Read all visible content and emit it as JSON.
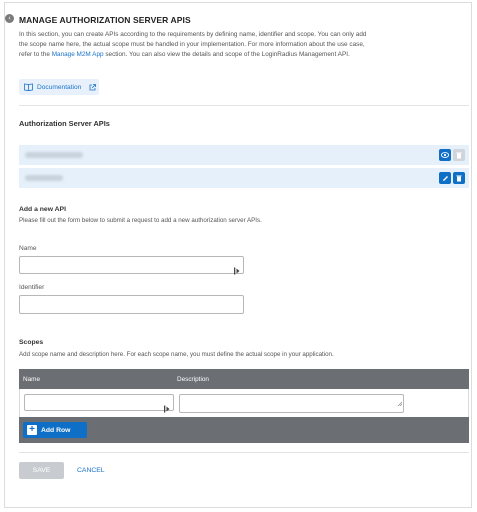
{
  "header": {
    "title": "MANAGE AUTHORIZATION SERVER APIS",
    "intro_pre": "In this section, you can create APIs according to the requirements by defining name, identifier and scope. You can only add the scope name here, the actual scope must be handled in your implementation. For more information about the use case, refer to the ",
    "intro_link": "Manage M2M App",
    "intro_post": " section. You can also view the details and scope of the LoginRadius Management API.",
    "doc_label": "Documentation"
  },
  "apis": {
    "heading": "Authorization Server APIs",
    "rows": [
      {
        "actions": [
          "eye-icon",
          "trash-icon"
        ]
      },
      {
        "actions": [
          "pencil-icon",
          "trash-icon"
        ]
      }
    ]
  },
  "add_api": {
    "heading": "Add a new API",
    "description": "Please fill out the form below to submit a request to add a new authorization server APIs.",
    "name_label": "Name",
    "name_value": "",
    "identifier_label": "Identifier",
    "identifier_value": ""
  },
  "scopes": {
    "heading": "Scopes",
    "description": "Add scope name and description here. For each scope name, you must define the actual scope in your application.",
    "col_name": "Name",
    "col_description": "Description",
    "add_row_label": "Add Row"
  },
  "footer": {
    "save_label": "SAVE",
    "cancel_label": "CANCEL"
  },
  "colors": {
    "accent": "#0f6fc6",
    "row_highlight": "#e6f0fa",
    "table_header": "#6b6e72",
    "disabled": "#c8ccd0"
  }
}
